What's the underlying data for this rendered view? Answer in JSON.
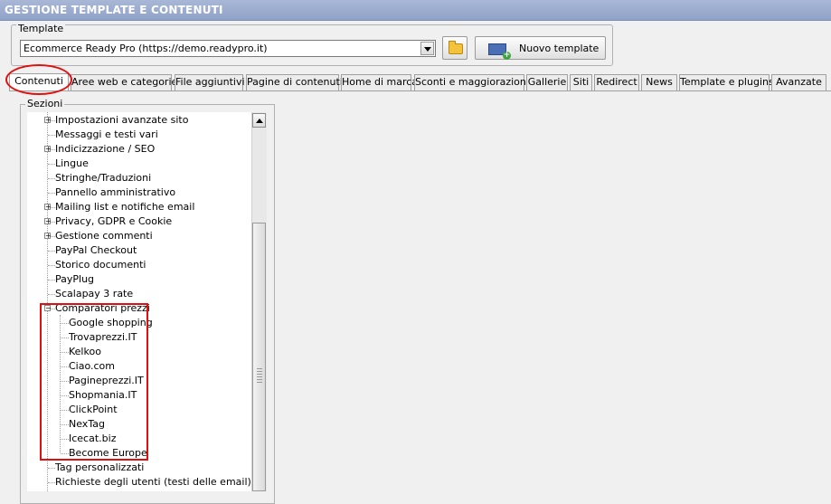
{
  "window": {
    "title": "GESTIONE TEMPLATE E CONTENUTI"
  },
  "template_group": {
    "legend": "Template",
    "selected": "Ecommerce Ready Pro (https://demo.readypro.it)",
    "new_template_label": "Nuovo template"
  },
  "tabs": [
    "Contenuti",
    "Aree web e categorie",
    "File aggiuntivi",
    "Pagine di contenuti",
    "Home di marca",
    "Sconti e maggiorazioni",
    "Gallerie",
    "Siti",
    "Redirect",
    "News",
    "Template e plugins",
    "Avanzate"
  ],
  "sections": {
    "legend": "Sezioni",
    "items": [
      "Impostazioni avanzate sito",
      "Messaggi e testi vari",
      "Indicizzazione / SEO",
      "Lingue",
      "Stringhe/Traduzioni",
      "Pannello amministrativo",
      "Mailing list e notifiche email",
      "Privacy, GDPR e Cookie",
      "Gestione commenti",
      "PayPal Checkout",
      "Storico documenti",
      "PayPlug",
      "Scalapay 3 rate",
      "Comparatori prezzi"
    ],
    "comparatori_children": [
      "Google shopping",
      "Trovaprezzi.IT",
      "Kelkoo",
      "Ciao.com",
      "Pagineprezzi.IT",
      "Shopmania.IT",
      "ClickPoint",
      "NexTag",
      "Icecat.biz",
      "Become Europe"
    ],
    "items_after": [
      "Tag personalizzati",
      "Richieste degli utenti (testi delle email)"
    ]
  },
  "colors": {
    "highlight_red": "#e01010",
    "titlebar": "#9aabd0"
  }
}
